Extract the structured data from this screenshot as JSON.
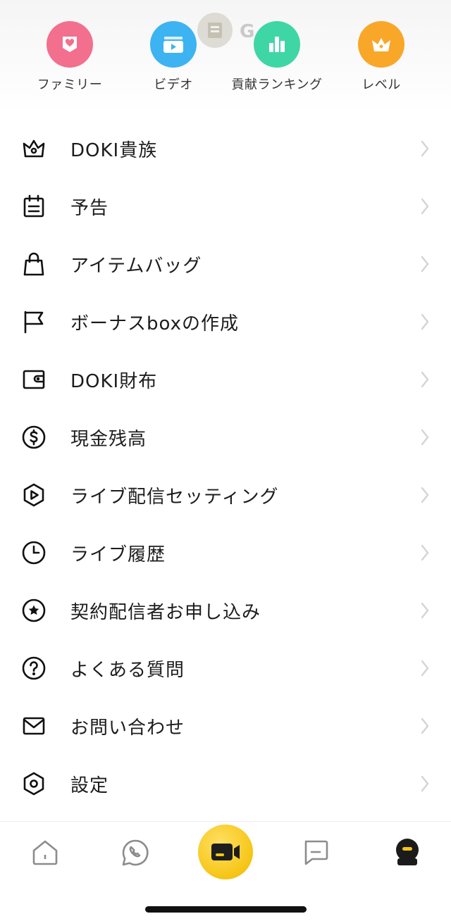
{
  "quick_actions": [
    {
      "label": "ファミリー",
      "color": "#f26f8d",
      "icon": "family-badge-icon"
    },
    {
      "label": "ビデオ",
      "color": "#3db3f2",
      "icon": "video-icon"
    },
    {
      "label": "貢献ランキング",
      "color": "#3fd6a5",
      "icon": "ranking-bars-icon"
    },
    {
      "label": "レベル",
      "color": "#f9a729",
      "icon": "crown-icon"
    }
  ],
  "peek_letter": "G",
  "menu": [
    {
      "label": "DOKI貴族",
      "icon": "crown-outline-icon"
    },
    {
      "label": "予告",
      "icon": "calendar-icon"
    },
    {
      "label": "アイテムバッグ",
      "icon": "shopping-bag-icon"
    },
    {
      "label": "ボーナスboxの作成",
      "icon": "flag-icon"
    },
    {
      "label": "DOKI財布",
      "icon": "wallet-icon"
    },
    {
      "label": "現金残高",
      "icon": "dollar-circle-icon"
    },
    {
      "label": "ライブ配信セッティング",
      "icon": "play-hexagon-icon"
    },
    {
      "label": "ライブ履歴",
      "icon": "clock-icon"
    },
    {
      "label": "契約配信者お申し込み",
      "icon": "star-circle-icon"
    },
    {
      "label": "よくある質問",
      "icon": "question-circle-icon"
    },
    {
      "label": "お問い合わせ",
      "icon": "mail-icon"
    },
    {
      "label": "設定",
      "icon": "settings-hexagon-icon"
    }
  ],
  "tabbar": [
    {
      "name": "home",
      "icon": "home-icon"
    },
    {
      "name": "calls",
      "icon": "phone-chat-icon"
    },
    {
      "name": "live",
      "icon": "live-camera-icon",
      "color": "#f6c514"
    },
    {
      "name": "messages",
      "icon": "message-icon"
    },
    {
      "name": "profile",
      "icon": "profile-avatar-icon"
    }
  ]
}
